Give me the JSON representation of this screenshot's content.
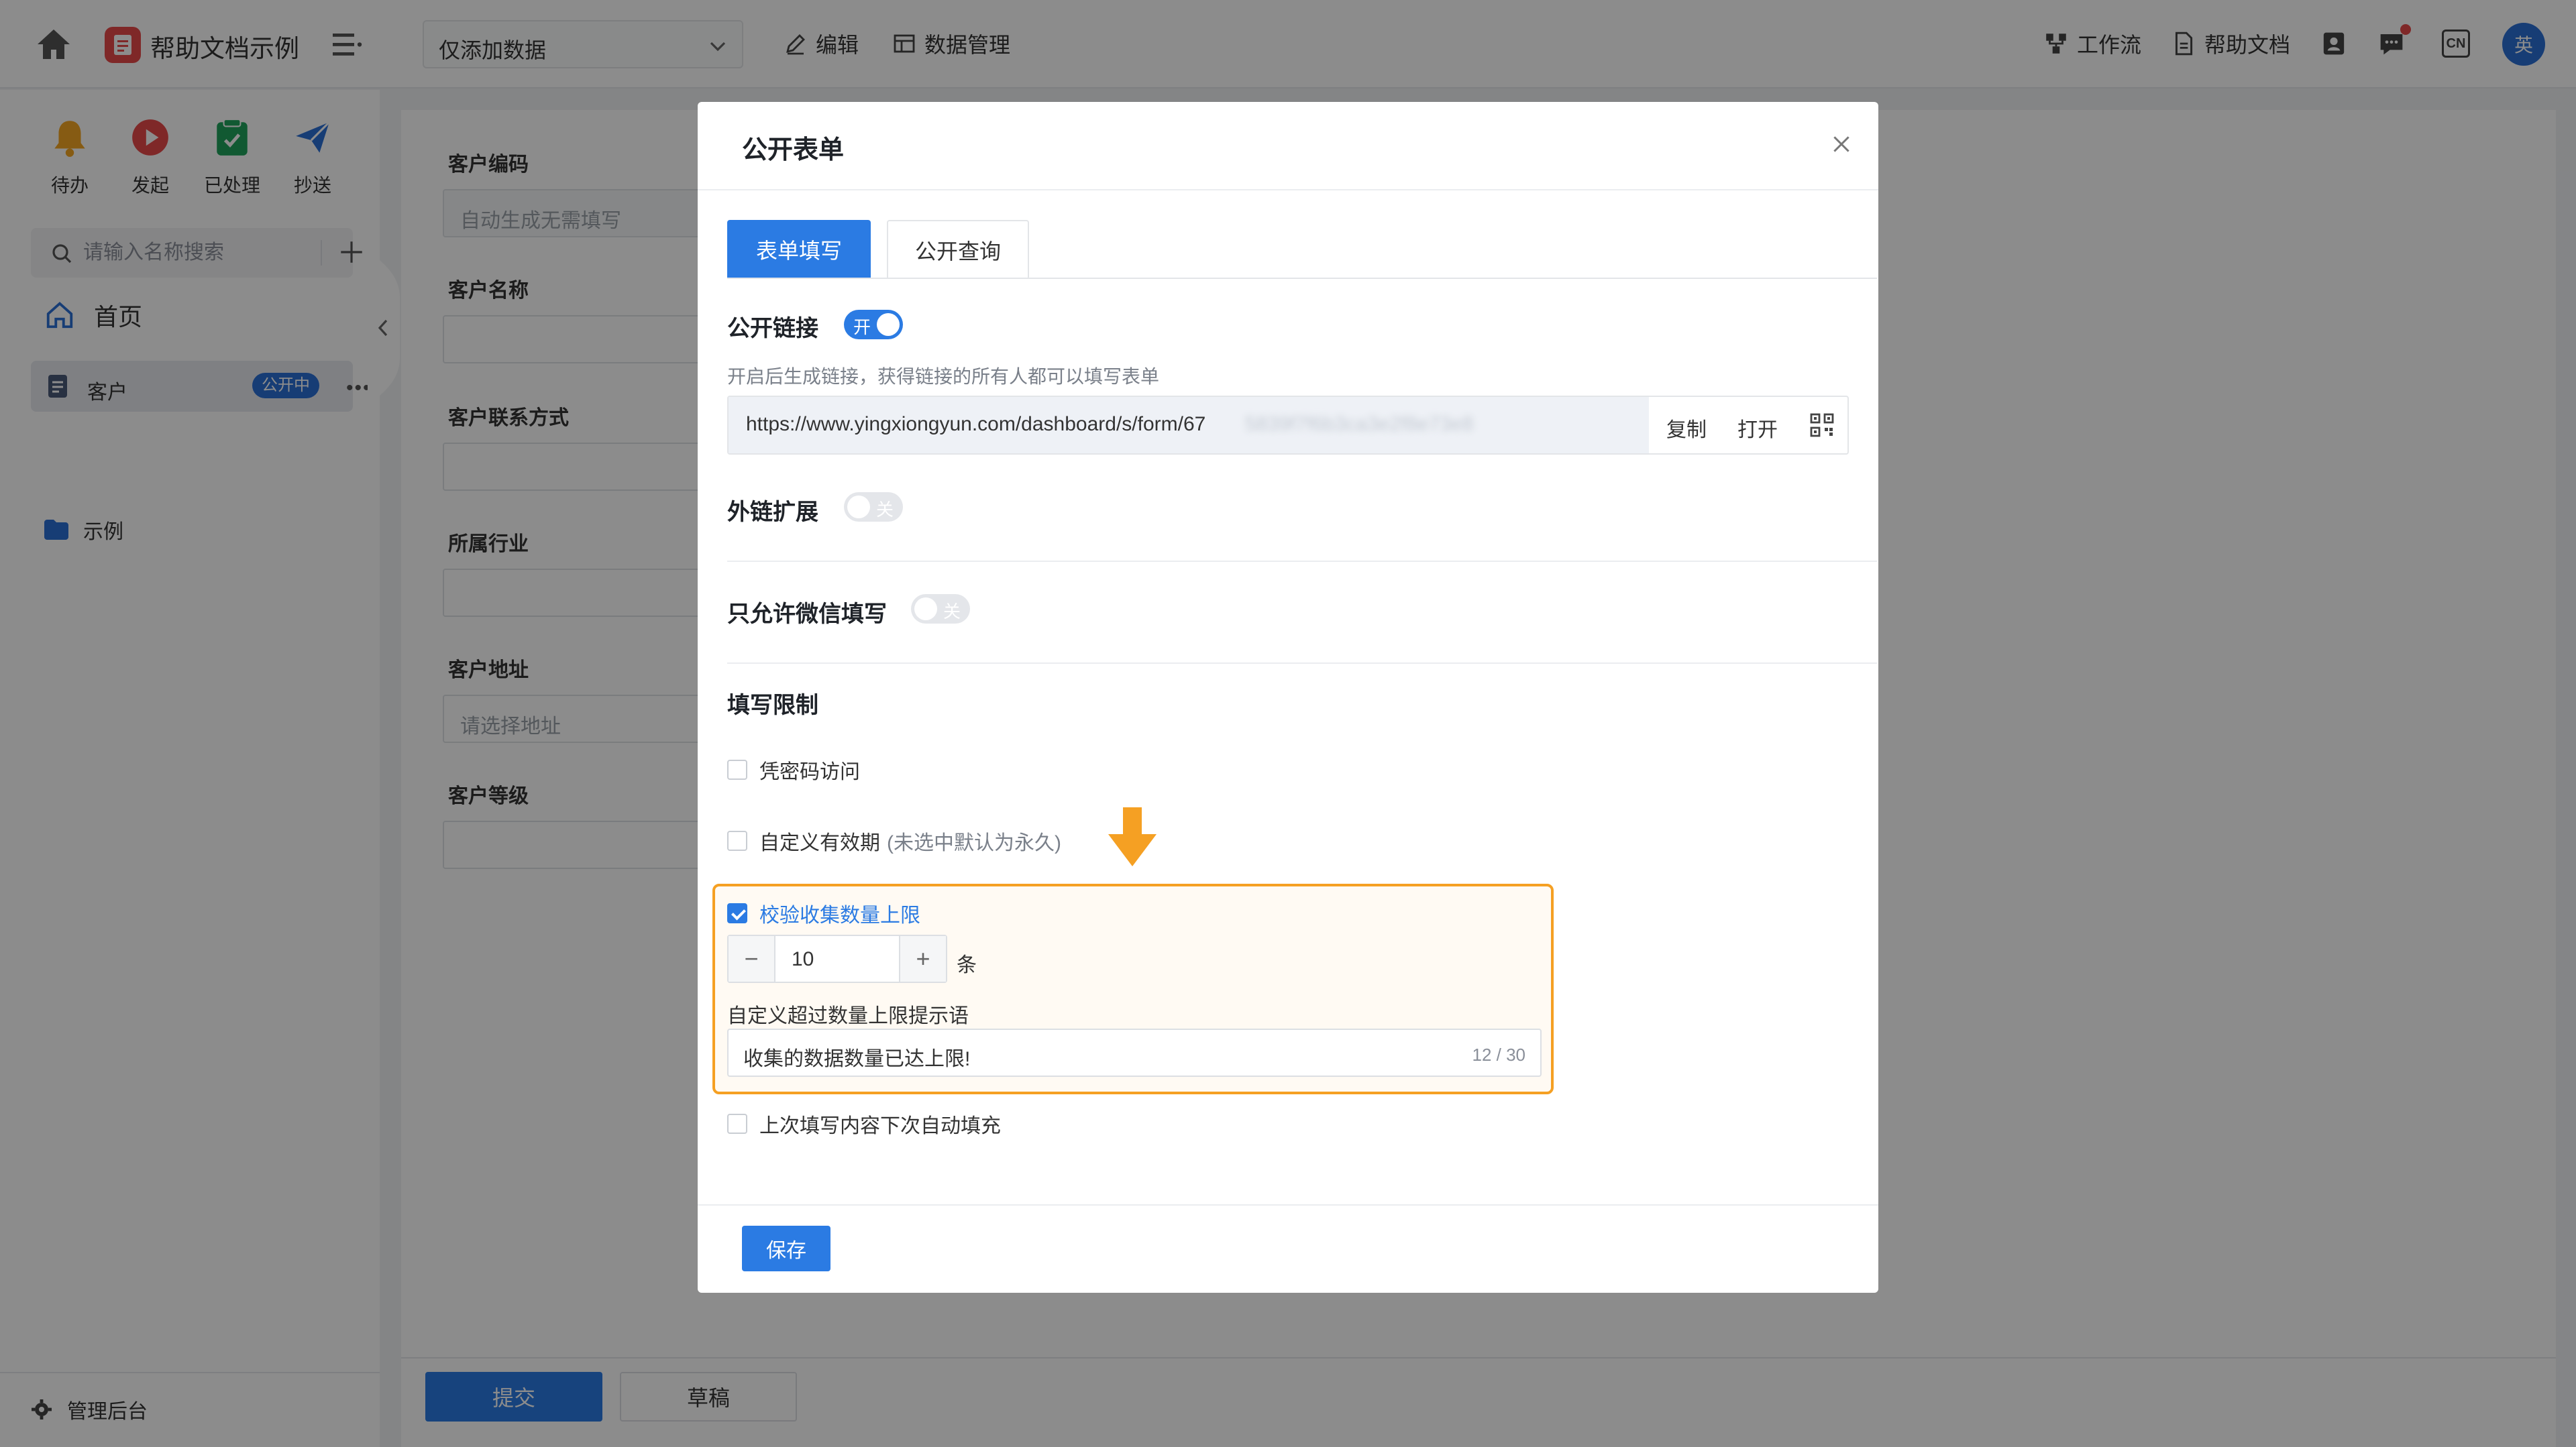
{
  "topbar": {
    "app_name": "帮助文档示例",
    "view_select": "仅添加数据",
    "edit_label": "编辑",
    "data_mgmt_label": "数据管理",
    "workflow_label": "工作流",
    "help_doc_label": "帮助文档",
    "lang_badge": "CN",
    "user_avatar_text": "英"
  },
  "sidebar": {
    "quick_actions": [
      {
        "label": "待办",
        "icon": "bell-icon",
        "color": "#f5a623"
      },
      {
        "label": "发起",
        "icon": "play-icon",
        "color": "#e84a4a"
      },
      {
        "label": "已处理",
        "icon": "check-doc-icon",
        "color": "#1fa35c"
      },
      {
        "label": "抄送",
        "icon": "send-icon",
        "color": "#2b6fd6"
      }
    ],
    "search_placeholder": "请输入名称搜索",
    "home_label": "首页",
    "active_item": {
      "label": "客户",
      "badge": "公开中"
    },
    "folder_label": "示例",
    "admin_label": "管理后台"
  },
  "form": {
    "fields": [
      {
        "label": "客户编码",
        "placeholder": "自动生成无需填写"
      },
      {
        "label": "客户名称",
        "placeholder": ""
      },
      {
        "label": "客户联系方式",
        "placeholder": ""
      },
      {
        "label": "所属行业",
        "placeholder": ""
      },
      {
        "label": "客户地址",
        "placeholder": "请选择地址"
      },
      {
        "label": "客户等级",
        "placeholder": ""
      }
    ],
    "submit_label": "提交",
    "draft_label": "草稿"
  },
  "modal": {
    "title": "公开表单",
    "tabs": [
      {
        "label": "表单填写",
        "active": true
      },
      {
        "label": "公开查询",
        "active": false
      }
    ],
    "public_link": {
      "label": "公开链接",
      "toggle_text": "开",
      "enabled": true,
      "hint": "开启后生成链接，获得链接的所有人都可以填写表单",
      "url": "https://www.yingxiongyun.com/dashboard/s/form/67",
      "url_redacted": "5839f7f6b3ca3e2f8e73e8",
      "copy_label": "复制",
      "open_label": "打开"
    },
    "external_ext": {
      "label": "外链扩展",
      "toggle_text": "关",
      "enabled": false
    },
    "wechat_only": {
      "label": "只允许微信填写",
      "toggle_text": "关",
      "enabled": false
    },
    "restrict_title": "填写限制",
    "options": {
      "password": {
        "label": "凭密码访问",
        "checked": false
      },
      "validity": {
        "label": "自定义有效期",
        "note": "(未选中默认为永久)",
        "checked": false
      },
      "limit": {
        "label": "校验收集数量上限",
        "checked": true,
        "value": "10",
        "unit": "条",
        "msg_label": "自定义超过数量上限提示语",
        "msg_value": "收集的数据数量已达上限!",
        "msg_count": "12 / 30"
      },
      "autofill": {
        "label": "上次填写内容下次自动填充",
        "checked": false
      }
    },
    "save_label": "保存"
  },
  "colors": {
    "primary": "#2b7be3",
    "highlight": "#f5a023",
    "overlay": "rgba(0,0,0,0.45)"
  }
}
